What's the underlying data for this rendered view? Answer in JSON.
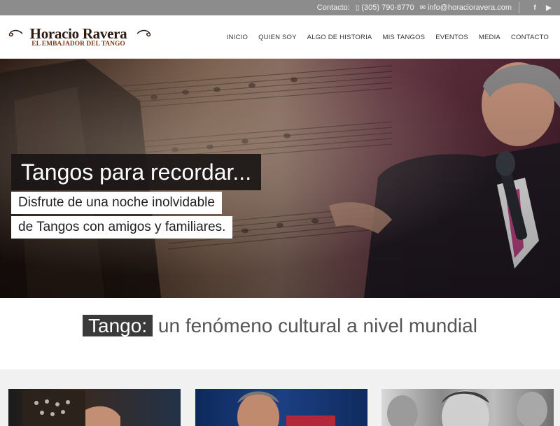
{
  "topbar": {
    "contact_label": "Contacto:",
    "phone": "(305) 790-8770",
    "email": "info@horacioravera.com",
    "phone_icon": "phone-icon",
    "email_icon": "envelope-icon",
    "social": [
      {
        "name": "facebook-icon",
        "glyph": "f"
      },
      {
        "name": "youtube-icon",
        "glyph": "▶"
      }
    ]
  },
  "logo": {
    "name": "Horacio Ravera",
    "tagline": "EL EMBAJADOR DEL TANGO"
  },
  "nav": [
    {
      "label": "INICIO"
    },
    {
      "label": "QUIEN SOY"
    },
    {
      "label": "ALGO DE HISTORIA"
    },
    {
      "label": "MIS TANGOS"
    },
    {
      "label": "EVENTOS"
    },
    {
      "label": "MEDIA"
    },
    {
      "label": "CONTACTO"
    }
  ],
  "hero": {
    "headline": "Tangos para recordar...",
    "subline1": "Disfrute de una noche inolvidable",
    "subline2": "de Tangos con amigos y familiares."
  },
  "section": {
    "highlight": "Tango:",
    "rest": " un fenómeno cultural a nivel mundial"
  },
  "colors": {
    "topbar_bg": "#8c8c8c",
    "title_highlight_bg": "#3a3a3a",
    "cards_bg": "#f1f1f1"
  }
}
